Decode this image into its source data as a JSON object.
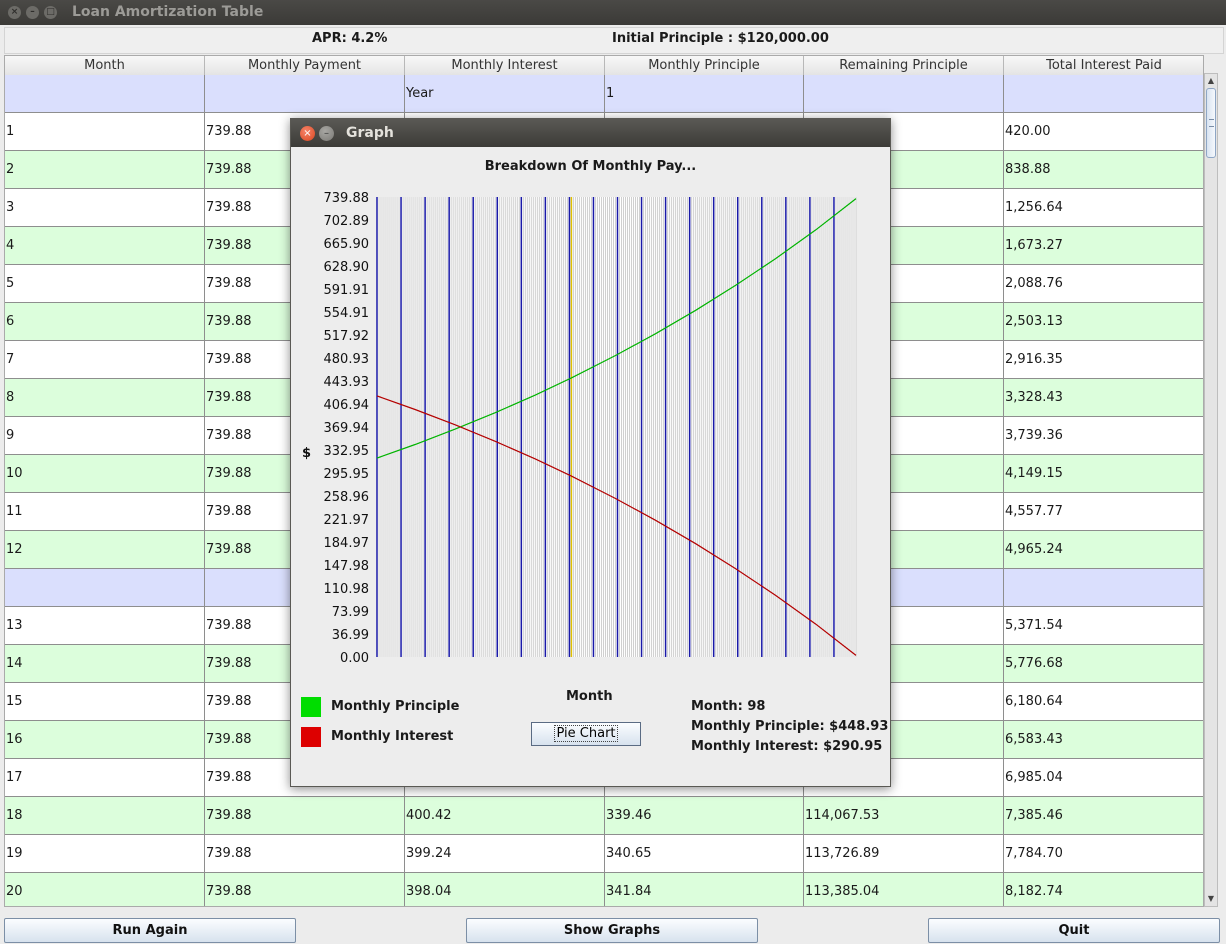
{
  "window": {
    "title": "Loan Amortization Table"
  },
  "summary": {
    "apr": "APR: 4.2%",
    "principle": "Initial Principle : $120,000.00"
  },
  "table": {
    "headers": [
      "Month",
      "Monthly Payment",
      "Monthly Interest",
      "Monthly Principle",
      "Remaining Principle",
      "Total Interest Paid"
    ],
    "year_row": [
      "",
      "",
      "Year",
      "1",
      "",
      ""
    ],
    "rows": [
      [
        "1",
        "739.88",
        "",
        "",
        "",
        "420.00"
      ],
      [
        "2",
        "739.88",
        "",
        "",
        "",
        "838.88"
      ],
      [
        "3",
        "739.88",
        "",
        "",
        "",
        "1,256.64"
      ],
      [
        "4",
        "739.88",
        "",
        "",
        "",
        "1,673.27"
      ],
      [
        "5",
        "739.88",
        "",
        "",
        "",
        "2,088.76"
      ],
      [
        "6",
        "739.88",
        "",
        "",
        "",
        "2,503.13"
      ],
      [
        "7",
        "739.88",
        "",
        "",
        "",
        "2,916.35"
      ],
      [
        "8",
        "739.88",
        "",
        "",
        "",
        "3,328.43"
      ],
      [
        "9",
        "739.88",
        "",
        "",
        "",
        "3,739.36"
      ],
      [
        "10",
        "739.88",
        "",
        "",
        "",
        "4,149.15"
      ],
      [
        "11",
        "739.88",
        "",
        "",
        "",
        "4,557.77"
      ],
      [
        "12",
        "739.88",
        "",
        "",
        "",
        "4,965.24"
      ],
      [
        "",
        "",
        "",
        "",
        "",
        ""
      ],
      [
        "13",
        "739.88",
        "",
        "",
        "",
        "5,371.54"
      ],
      [
        "14",
        "739.88",
        "",
        "",
        "",
        "5,776.68"
      ],
      [
        "15",
        "739.88",
        "",
        "",
        "",
        "6,180.64"
      ],
      [
        "16",
        "739.88",
        "",
        "",
        "",
        "6,583.43"
      ],
      [
        "17",
        "739.88",
        "",
        "",
        "",
        "6,985.04"
      ],
      [
        "18",
        "739.88",
        "400.42",
        "339.46",
        "114,067.53",
        "7,385.46"
      ],
      [
        "19",
        "739.88",
        "399.24",
        "340.65",
        "113,726.89",
        "7,784.70"
      ],
      [
        "20",
        "739.88",
        "398.04",
        "341.84",
        "113,385.04",
        "8,182.74"
      ]
    ]
  },
  "buttons": {
    "run_again": "Run Again",
    "show_graphs": "Show Graphs",
    "quit": "Quit"
  },
  "dialog": {
    "title": "Graph",
    "pie_button": "Pie Chart",
    "legend": [
      {
        "label": "Monthly Principle",
        "color": "#00dd00"
      },
      {
        "label": "Monthly Interest",
        "color": "#dd0000"
      }
    ],
    "info": {
      "month": "Month: 98",
      "principle": "Monthly Principle: $448.93",
      "interest": "Monthly Interest: $290.95"
    }
  },
  "chart_data": {
    "type": "line",
    "title": "Breakdown Of Monthly Pay...",
    "xlabel": "Month",
    "ylabel": "$",
    "ylim": [
      0,
      739.88
    ],
    "xlim": [
      1,
      240
    ],
    "yticks": [
      "739.88",
      "702.89",
      "665.90",
      "628.90",
      "591.91",
      "554.91",
      "517.92",
      "480.93",
      "443.93",
      "406.94",
      "369.94",
      "332.95",
      "295.95",
      "258.96",
      "221.97",
      "184.97",
      "147.98",
      "110.98",
      "73.99",
      "36.99",
      "0.00"
    ],
    "selected_month": 98,
    "series": [
      {
        "name": "Monthly Principle",
        "color": "#00b400",
        "x": [
          1,
          20,
          40,
          60,
          80,
          98,
          120,
          140,
          160,
          180,
          200,
          220,
          240
        ],
        "values": [
          319.88,
          341.84,
          366.5,
          392.9,
          421.2,
          448.93,
          485.0,
          520.0,
          557.6,
          597.8,
          641.0,
          687.2,
          737.3
        ]
      },
      {
        "name": "Monthly Interest",
        "color": "#b40000",
        "x": [
          1,
          20,
          40,
          60,
          80,
          98,
          120,
          140,
          160,
          180,
          200,
          220,
          240
        ],
        "values": [
          420.0,
          398.04,
          373.4,
          347.0,
          318.7,
          290.95,
          254.9,
          219.9,
          182.3,
          142.1,
          98.9,
          52.7,
          2.58
        ]
      }
    ]
  }
}
